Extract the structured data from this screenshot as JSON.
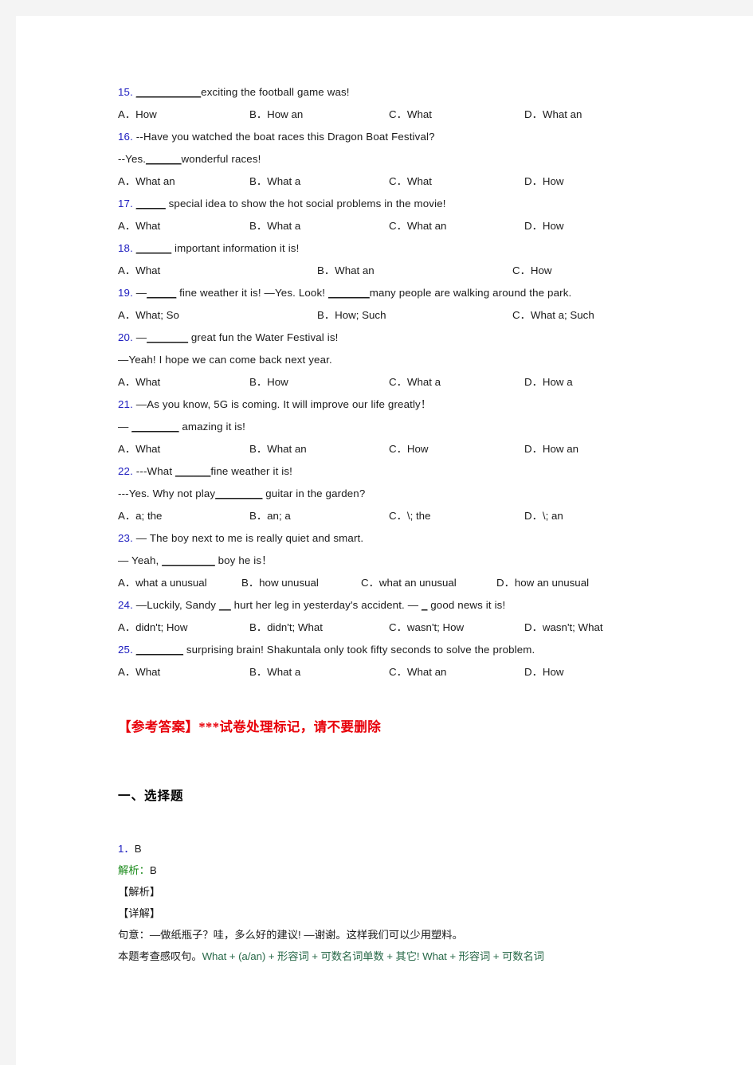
{
  "document": {
    "questions": [
      {
        "number": "15.",
        "stem_pre": "",
        "stem_blank": "___________",
        "stem_post": "exciting the football game was!",
        "options": [
          "A．How",
          "B．How an",
          "C．What",
          "D．What an"
        ],
        "layout": "c4"
      },
      {
        "number": "16.",
        "line1": "--Have you watched the boat races this Dragon Boat Festival?",
        "line2_pre": "--Yes.",
        "line2_blank": "______",
        "line2_post": "wonderful races!",
        "options": [
          "A．What an",
          "B．What a",
          "C．What",
          "D．How"
        ],
        "layout": "c4"
      },
      {
        "number": "17.",
        "stem_blank": "_____",
        "stem_post": " special idea to show the hot social problems in the movie!",
        "options": [
          "A．What",
          "B．What a",
          "C．What an",
          "D．How"
        ],
        "layout": "c4"
      },
      {
        "number": "18.",
        "stem_blank": "______",
        "stem_post": " important information it is!",
        "options": [
          "A．What",
          "B．What an",
          "C．How"
        ],
        "layout": "c3"
      },
      {
        "number": "19.",
        "stem_pre": "—",
        "stem_blank": "_____",
        "stem_mid": " fine weather it is!   —Yes. Look! ",
        "stem_blank2": "_______",
        "stem_post": "many people are walking around the park.",
        "options": [
          "A．What; So",
          "B．How; Such",
          "C．What a; Such"
        ],
        "layout": "c3"
      },
      {
        "number": "20.",
        "line1_pre": "—",
        "line1_blank": "_______",
        "line1_post": " great fun the Water Festival is!",
        "line2": "—Yeah! I hope we can come back next year.",
        "options": [
          "A．What",
          "B．How",
          "C．What a",
          "D．How a"
        ],
        "layout": "c4"
      },
      {
        "number": "21.",
        "line1": "—As you know, 5G is coming. It will improve our life greatly！",
        "line2_pre": "— ",
        "line2_blank": "________",
        "line2_post": " amazing it is!",
        "options": [
          "A．What",
          "B．What an",
          "C．How",
          "D．How an"
        ],
        "layout": "c4"
      },
      {
        "number": "22.",
        "line1_pre": "---What ",
        "line1_blank": "______",
        "line1_post": "fine weather it is!",
        "line2_pre": "---Yes. Why not play",
        "line2_blank": "________",
        "line2_post": " guitar in the garden?",
        "options": [
          "A．a; the",
          "B．an; a",
          "C．\\; the",
          "D．\\; an"
        ],
        "layout": "c4"
      },
      {
        "number": "23.",
        "line1": "— The boy next to me is really quiet and smart.",
        "line2_pre": "— Yeah, ",
        "line2_blank": "_________",
        "line2_post": " boy he is！",
        "options": [
          "A．what a unusual",
          "B．how unusual",
          "C．what an unusual",
          "D．how an unusual"
        ],
        "layout": "c4t"
      },
      {
        "number": "24.",
        "stem_pre": "—Luckily, Sandy ",
        "stem_blank": "__",
        "stem_mid": " hurt her leg in yesterday's accident. — ",
        "stem_blank2": "_",
        "stem_post": " good news it is!",
        "options": [
          "A．didn't; How",
          "B．didn't; What",
          "C．wasn't; How",
          "D．wasn't; What"
        ],
        "layout": "c4"
      },
      {
        "number": "25.",
        "stem_blank": "________",
        "stem_post": " surprising brain! Shakuntala only took fifty seconds to solve the problem.",
        "options": [
          "A．What",
          "B．What a",
          "C．What an",
          "D．How"
        ],
        "layout": "c4"
      }
    ],
    "answer_key": {
      "marker": "【参考答案】***试卷处理标记，请不要删除",
      "section_title": "一、选择题",
      "answer_number_label": "1．",
      "answer_number_value": "B",
      "jiexi_label": "解析：",
      "jiexi_value": "B",
      "bracket_jiexi": "【解析】",
      "bracket_xiangjie": "【详解】",
      "meaning_line": "句意：—做纸瓶子？哇，多么好的建议! —谢谢。这样我们可以少用塑料。",
      "rule_line_pre": "本题考查感叹句。",
      "rule_line_body": "What + (a/an) + 形容词 + 可数名词单数 + 其它! What + 形容词 + 可数名词"
    },
    "colors": {
      "question_number": "#2020c0",
      "answer_marker_red": "#e8000a",
      "jiexi_green": "#1a8a1a",
      "body_text": "#1a1a1a",
      "page_background": "#ffffff",
      "outer_background": "#f4f4f4"
    }
  }
}
